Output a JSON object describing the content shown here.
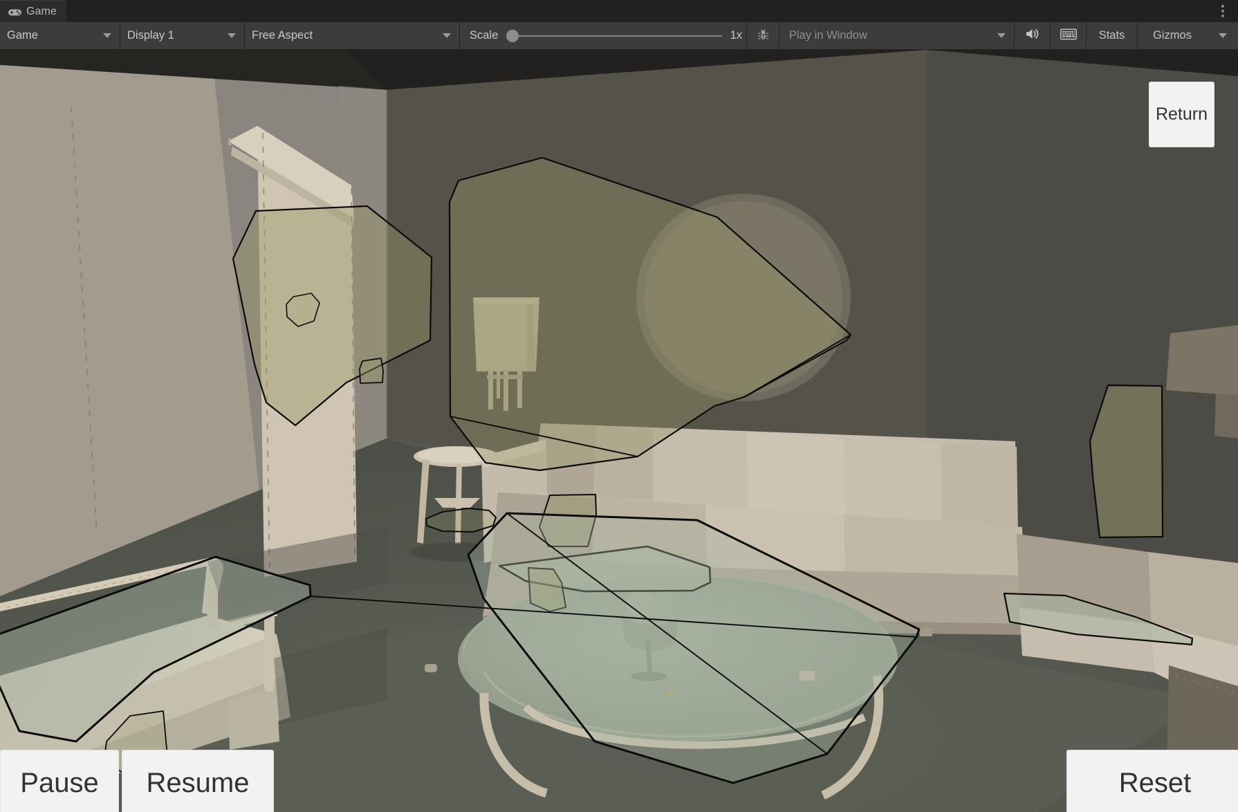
{
  "window": {
    "tab_label": "Game",
    "tab_icon": "gamepad-icon",
    "overflow_menu_icon": "kebab-menu-icon"
  },
  "toolbar": {
    "view_mode": "Game",
    "display": "Display 1",
    "aspect": "Free Aspect",
    "scale_label": "Scale",
    "scale_value": "1x",
    "scale_slider": {
      "min": 1,
      "max": 10,
      "value": 1,
      "position_pct": 0
    },
    "bug_icon": "bug-icon",
    "play_mode_placeholder": "Play in Window",
    "mute_icon": "speaker-icon",
    "keyboard_icon": "keyboard-icon",
    "stats_label": "Stats",
    "gizmos_label": "Gizmos",
    "gizmos_caret_icon": "chevron-down-icon"
  },
  "game_overlay": {
    "return_label": "Return",
    "pause_label": "Pause",
    "resume_label": "Resume",
    "reset_label": "Reset"
  },
  "scene": {
    "description": "Low-poly living room interior rendered in Unity Game view with semi-transparent annotation polygons overlaid on walls, sofa, bench and coffee table.",
    "palette": {
      "wall_left": "#8d8881",
      "wall_back_dark": "#54524e",
      "wall_right_dark": "#4d4b47",
      "ceiling": "#272522",
      "floor": "#55584f",
      "rug": "#5c6057",
      "sofa_light": "#c9c0b1",
      "sofa_mid": "#b4aa9b",
      "sofa_shadow": "#9a9182",
      "wall_art": "#cfc5b2",
      "wood": "#cdc2ae",
      "annotation_fill": "#8b8a65",
      "annotation_stroke": "#0c0c0c",
      "glass_fill": "#aab6a4"
    }
  }
}
